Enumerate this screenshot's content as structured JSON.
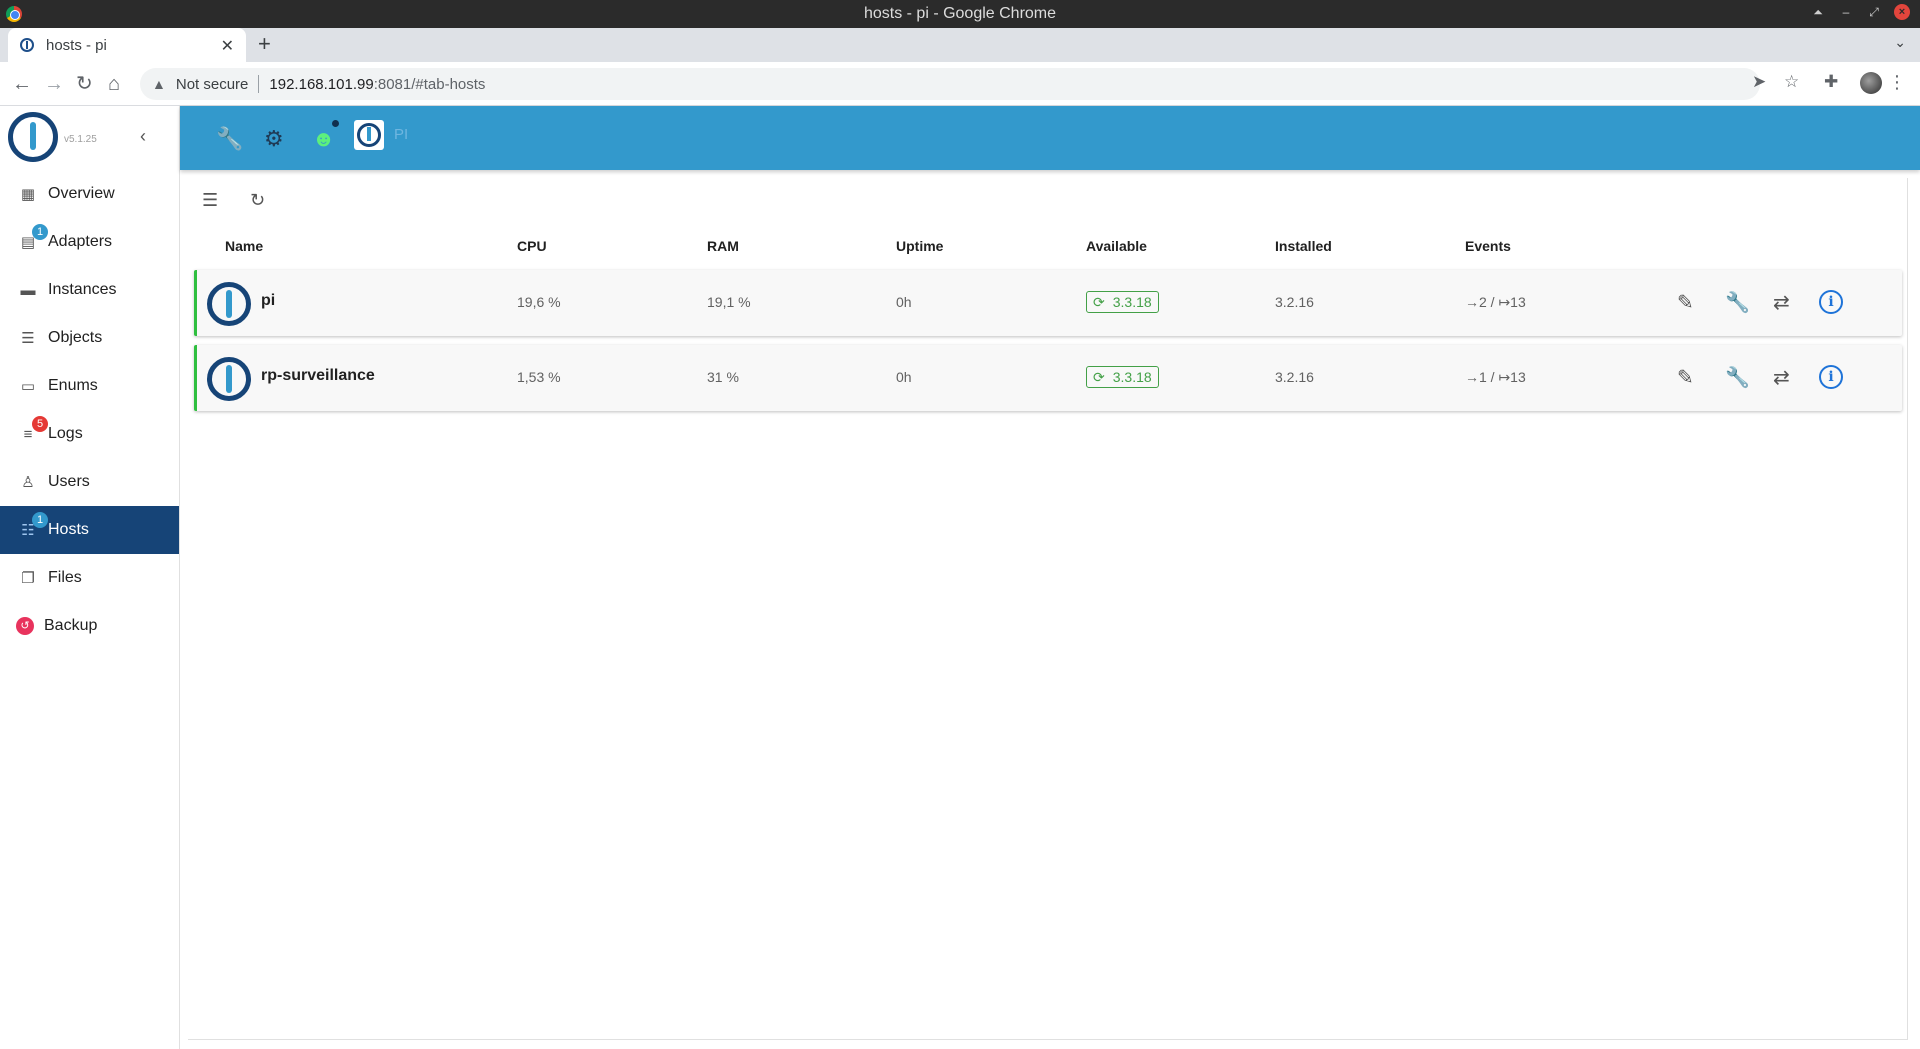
{
  "window": {
    "title": "hosts - pi - Google Chrome"
  },
  "tab": {
    "title": "hosts - pi"
  },
  "address": {
    "security": "Not secure",
    "host": "192.168.101.99",
    "path": ":8081/#tab-hosts"
  },
  "sidebar": {
    "version": "v5.1.25",
    "items": [
      {
        "label": "Overview",
        "badge": ""
      },
      {
        "label": "Adapters",
        "badge": "1"
      },
      {
        "label": "Instances",
        "badge": ""
      },
      {
        "label": "Objects",
        "badge": ""
      },
      {
        "label": "Enums",
        "badge": ""
      },
      {
        "label": "Logs",
        "badge": "5"
      },
      {
        "label": "Users",
        "badge": ""
      },
      {
        "label": "Hosts",
        "badge": "1"
      },
      {
        "label": "Files",
        "badge": ""
      },
      {
        "label": "Backup",
        "badge": ""
      }
    ]
  },
  "appbar": {
    "host_name": "PI"
  },
  "table": {
    "headers": [
      "Name",
      "CPU",
      "RAM",
      "Uptime",
      "Available",
      "Installed",
      "Events"
    ],
    "rows": [
      {
        "name": "pi",
        "cpu": "19,6 %",
        "ram": "19,1 %",
        "uptime": "0h",
        "available": "3.3.18",
        "installed": "3.2.16",
        "events": "→2 / ↦13"
      },
      {
        "name": "rp-surveillance",
        "cpu": "1,53 %",
        "ram": "31 %",
        "uptime": "0h",
        "available": "3.3.18",
        "installed": "3.2.16",
        "events": "→1 / ↦13"
      }
    ]
  },
  "colors": {
    "accent": "#3399cc",
    "navy": "#164477",
    "ok": "#43a047"
  }
}
